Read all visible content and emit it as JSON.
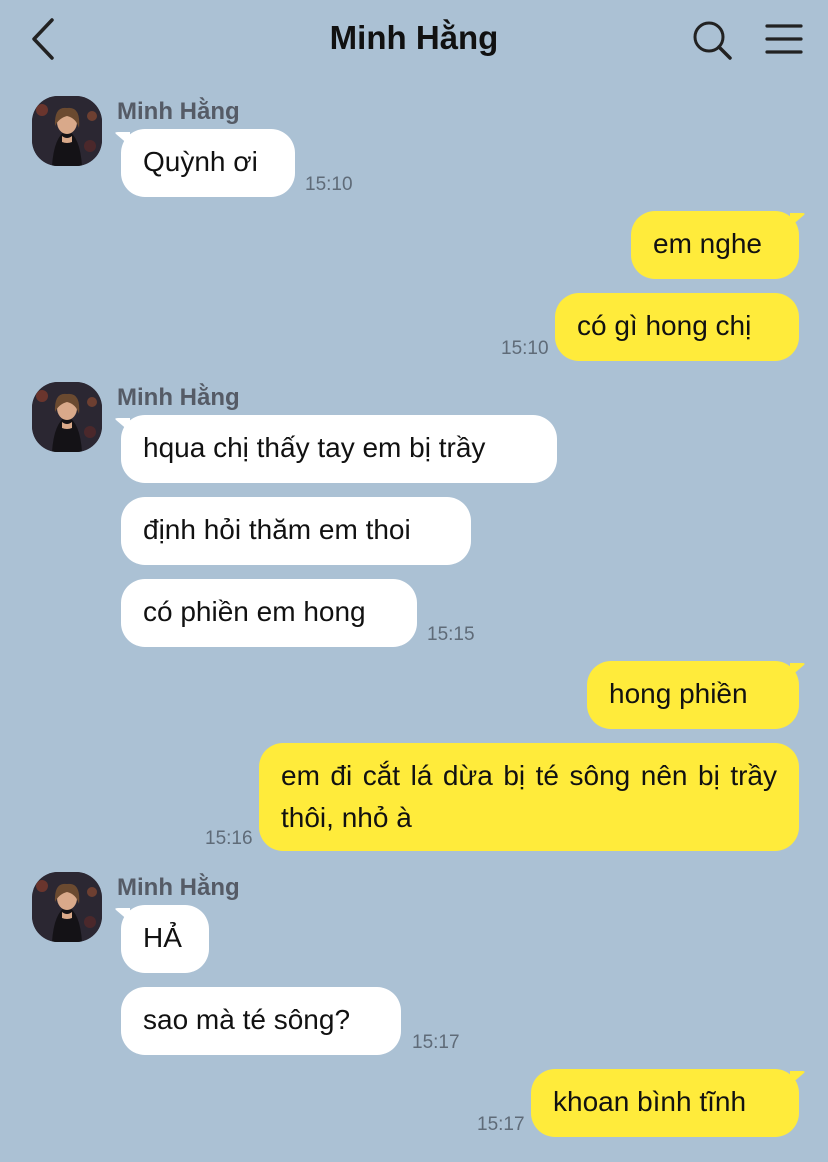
{
  "header": {
    "title": "Minh Hằng"
  },
  "colors": {
    "background": "#abc1d4",
    "incoming_bubble": "#ffffff",
    "outgoing_bubble": "#ffeb3b"
  },
  "icons": {
    "back": "chevron-left-icon",
    "search": "search-icon",
    "menu": "menu-icon"
  },
  "messages": [
    {
      "sender": "Minh Hằng",
      "text": "Quỳnh ơi",
      "time": "15:10"
    },
    {
      "text": "em nghe"
    },
    {
      "text": "có gì hong chị",
      "time": "15:10"
    },
    {
      "sender": "Minh Hằng",
      "text": "hqua chị thấy tay em bị trầy"
    },
    {
      "text": "định hỏi thăm em thoi"
    },
    {
      "text": "có phiền em hong",
      "time": "15:15"
    },
    {
      "text": "hong phiền"
    },
    {
      "text": "em đi cắt lá dừa bị té sông nên bị trầy thôi, nhỏ à",
      "time": "15:16"
    },
    {
      "sender": "Minh Hằng",
      "text": "HẢ"
    },
    {
      "text": "sao mà té sông?",
      "time": "15:17"
    },
    {
      "text": "khoan bình tĩnh",
      "time": "15:17"
    }
  ]
}
